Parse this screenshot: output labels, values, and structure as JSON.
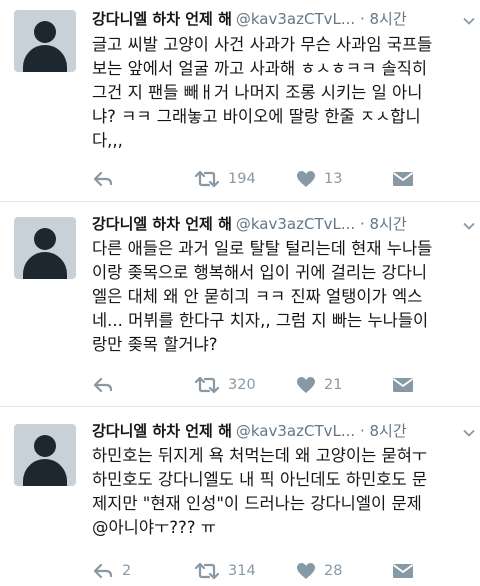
{
  "tweets": [
    {
      "name": "강다니엘 하차 언제 해",
      "handle": "@kav3azCTvL...",
      "dot": "·",
      "time": "8시간",
      "text": "글고 씨발 고양이 사건 사과가 무슨 사과임 국프들\n보는 앞에서 얼굴 까고 사과해 ㅎㅅㅎㅋㅋ 솔직히\n그건 지 팬들 빼ㅐ거 나머지 조롱 시키는 일 아니\n냐? ㅋㅋ 그래놓고 바이오에 딸랑 한줄 ㅈㅅ합니\n다,,,",
      "reply_count": "",
      "retweet_count": "194",
      "like_count": "13"
    },
    {
      "name": "강다니엘 하차 언제 해",
      "handle": "@kav3azCTvL...",
      "dot": "·",
      "time": "8시간",
      "text": "다른 애들은 과거 일로 탈탈 털리는데 현재 누나들\n이랑 좆목으로 행복해서 입이 귀에 걸리는 강다니\n엘은 대체 왜 안 묻히긔 ㅋㅋ 진짜 얼탱이가 엑스\n네... 머뷔를 한다구 치자,, 그럼 지 빠는 누나들이\n랑만 좆목 할거냐?",
      "reply_count": "",
      "retweet_count": "320",
      "like_count": "21"
    },
    {
      "name": "강다니엘 하차 언제 해",
      "handle": "@kav3azCTvL...",
      "dot": "·",
      "time": "8시간",
      "text": "하민호는 뒤지게 욕 처먹는데 왜 고양이는 묻혀ㅜ\n하민호도 강다니엘도 내 픽 아닌데도 하민호도 문\n제지만 \"현재 인성\"이 드러나는 강다니엘이 문제\n@아니야ㅜ??? ㅠ",
      "reply_count": "2",
      "retweet_count": "314",
      "like_count": "28"
    }
  ],
  "colors": {
    "text": "#14171a",
    "secondary": "#657786",
    "icon": "#8899a6",
    "divider": "#e1e8ed",
    "avatar_bg": "#c9d1d8",
    "avatar_fg": "#1c2730"
  }
}
